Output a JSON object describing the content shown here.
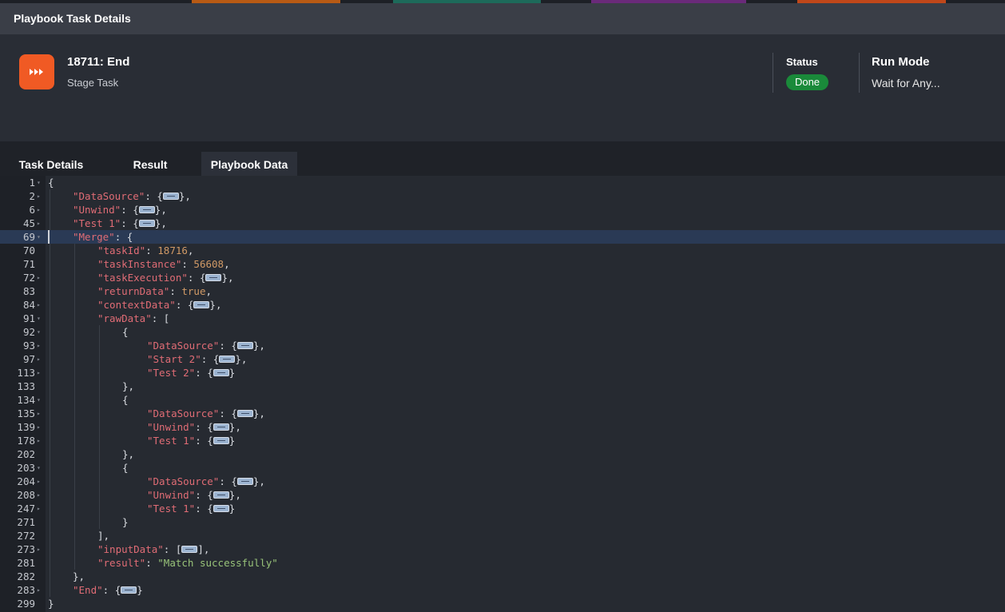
{
  "dialog": {
    "title": "Playbook Task Details"
  },
  "task": {
    "title": "18711: End",
    "subtitle": "Stage Task",
    "icon": "fast-forward-icon",
    "icon_color": "#f05a24"
  },
  "status": {
    "label": "Status",
    "value": "Done",
    "color": "#1a8a3a"
  },
  "run_mode": {
    "label": "Run Mode",
    "value": "Wait for Any..."
  },
  "tabs": [
    {
      "label": "Task Details",
      "active": false
    },
    {
      "label": "Result",
      "active": false
    },
    {
      "label": "Playbook Data",
      "active": true
    }
  ],
  "editor": {
    "lines": [
      {
        "n": "1",
        "fold": "open",
        "indent": 0,
        "tokens": [
          [
            "p",
            "{"
          ]
        ]
      },
      {
        "n": "2",
        "fold": "closed",
        "indent": 1,
        "tokens": [
          [
            "k",
            "\"DataSource\""
          ],
          [
            "p",
            ": {"
          ],
          [
            "w",
            ""
          ],
          [
            "p",
            "},"
          ]
        ]
      },
      {
        "n": "6",
        "fold": "closed",
        "indent": 1,
        "tokens": [
          [
            "k",
            "\"Unwind\""
          ],
          [
            "p",
            ": {"
          ],
          [
            "w",
            ""
          ],
          [
            "p",
            "},"
          ]
        ]
      },
      {
        "n": "45",
        "fold": "closed",
        "indent": 1,
        "tokens": [
          [
            "k",
            "\"Test 1\""
          ],
          [
            "p",
            ": {"
          ],
          [
            "w",
            ""
          ],
          [
            "p",
            "},"
          ]
        ]
      },
      {
        "n": "69",
        "fold": "open",
        "indent": 1,
        "hl": true,
        "tokens": [
          [
            "k",
            "\"Merge\""
          ],
          [
            "p",
            ": {"
          ]
        ]
      },
      {
        "n": "70",
        "fold": "",
        "indent": 2,
        "tokens": [
          [
            "k",
            "\"taskId\""
          ],
          [
            "p",
            ": "
          ],
          [
            "n",
            "18716"
          ],
          [
            "p",
            ","
          ]
        ]
      },
      {
        "n": "71",
        "fold": "",
        "indent": 2,
        "tokens": [
          [
            "k",
            "\"taskInstance\""
          ],
          [
            "p",
            ": "
          ],
          [
            "n",
            "56608"
          ],
          [
            "p",
            ","
          ]
        ]
      },
      {
        "n": "72",
        "fold": "closed",
        "indent": 2,
        "tokens": [
          [
            "k",
            "\"taskExecution\""
          ],
          [
            "p",
            ": {"
          ],
          [
            "w",
            ""
          ],
          [
            "p",
            "},"
          ]
        ]
      },
      {
        "n": "83",
        "fold": "",
        "indent": 2,
        "tokens": [
          [
            "k",
            "\"returnData\""
          ],
          [
            "p",
            ": "
          ],
          [
            "n",
            "true"
          ],
          [
            "p",
            ","
          ]
        ]
      },
      {
        "n": "84",
        "fold": "closed",
        "indent": 2,
        "tokens": [
          [
            "k",
            "\"contextData\""
          ],
          [
            "p",
            ": {"
          ],
          [
            "w",
            ""
          ],
          [
            "p",
            "},"
          ]
        ]
      },
      {
        "n": "91",
        "fold": "open",
        "indent": 2,
        "tokens": [
          [
            "k",
            "\"rawData\""
          ],
          [
            "p",
            ": ["
          ]
        ]
      },
      {
        "n": "92",
        "fold": "open",
        "indent": 3,
        "tokens": [
          [
            "p",
            "{"
          ]
        ]
      },
      {
        "n": "93",
        "fold": "closed",
        "indent": 4,
        "tokens": [
          [
            "k",
            "\"DataSource\""
          ],
          [
            "p",
            ": {"
          ],
          [
            "w",
            ""
          ],
          [
            "p",
            "},"
          ]
        ]
      },
      {
        "n": "97",
        "fold": "closed",
        "indent": 4,
        "tokens": [
          [
            "k",
            "\"Start 2\""
          ],
          [
            "p",
            ": {"
          ],
          [
            "w",
            ""
          ],
          [
            "p",
            "},"
          ]
        ]
      },
      {
        "n": "113",
        "fold": "closed",
        "indent": 4,
        "tokens": [
          [
            "k",
            "\"Test 2\""
          ],
          [
            "p",
            ": {"
          ],
          [
            "w",
            ""
          ],
          [
            "p",
            "}"
          ]
        ]
      },
      {
        "n": "133",
        "fold": "",
        "indent": 3,
        "tokens": [
          [
            "p",
            "},"
          ]
        ]
      },
      {
        "n": "134",
        "fold": "open",
        "indent": 3,
        "tokens": [
          [
            "p",
            "{"
          ]
        ]
      },
      {
        "n": "135",
        "fold": "closed",
        "indent": 4,
        "tokens": [
          [
            "k",
            "\"DataSource\""
          ],
          [
            "p",
            ": {"
          ],
          [
            "w",
            ""
          ],
          [
            "p",
            "},"
          ]
        ]
      },
      {
        "n": "139",
        "fold": "closed",
        "indent": 4,
        "tokens": [
          [
            "k",
            "\"Unwind\""
          ],
          [
            "p",
            ": {"
          ],
          [
            "w",
            ""
          ],
          [
            "p",
            "},"
          ]
        ]
      },
      {
        "n": "178",
        "fold": "closed",
        "indent": 4,
        "tokens": [
          [
            "k",
            "\"Test 1\""
          ],
          [
            "p",
            ": {"
          ],
          [
            "w",
            ""
          ],
          [
            "p",
            "}"
          ]
        ]
      },
      {
        "n": "202",
        "fold": "",
        "indent": 3,
        "tokens": [
          [
            "p",
            "},"
          ]
        ]
      },
      {
        "n": "203",
        "fold": "open",
        "indent": 3,
        "tokens": [
          [
            "p",
            "{"
          ]
        ]
      },
      {
        "n": "204",
        "fold": "closed",
        "indent": 4,
        "tokens": [
          [
            "k",
            "\"DataSource\""
          ],
          [
            "p",
            ": {"
          ],
          [
            "w",
            ""
          ],
          [
            "p",
            "},"
          ]
        ]
      },
      {
        "n": "208",
        "fold": "closed",
        "indent": 4,
        "tokens": [
          [
            "k",
            "\"Unwind\""
          ],
          [
            "p",
            ": {"
          ],
          [
            "w",
            ""
          ],
          [
            "p",
            "},"
          ]
        ]
      },
      {
        "n": "247",
        "fold": "closed",
        "indent": 4,
        "tokens": [
          [
            "k",
            "\"Test 1\""
          ],
          [
            "p",
            ": {"
          ],
          [
            "w",
            ""
          ],
          [
            "p",
            "}"
          ]
        ]
      },
      {
        "n": "271",
        "fold": "",
        "indent": 3,
        "tokens": [
          [
            "p",
            "}"
          ]
        ]
      },
      {
        "n": "272",
        "fold": "",
        "indent": 2,
        "tokens": [
          [
            "p",
            "],"
          ]
        ]
      },
      {
        "n": "273",
        "fold": "closed",
        "indent": 2,
        "tokens": [
          [
            "k",
            "\"inputData\""
          ],
          [
            "p",
            ": ["
          ],
          [
            "w",
            ""
          ],
          [
            "p",
            "],"
          ]
        ]
      },
      {
        "n": "281",
        "fold": "",
        "indent": 2,
        "tokens": [
          [
            "k",
            "\"result\""
          ],
          [
            "p",
            ": "
          ],
          [
            "s",
            "\"Match successfully\""
          ]
        ]
      },
      {
        "n": "282",
        "fold": "",
        "indent": 1,
        "tokens": [
          [
            "p",
            "},"
          ]
        ]
      },
      {
        "n": "283",
        "fold": "closed",
        "indent": 1,
        "tokens": [
          [
            "k",
            "\"End\""
          ],
          [
            "p",
            ": {"
          ],
          [
            "w",
            ""
          ],
          [
            "p",
            "}"
          ]
        ]
      },
      {
        "n": "299",
        "fold": "",
        "indent": 0,
        "tokens": [
          [
            "p",
            "}"
          ]
        ]
      }
    ]
  }
}
